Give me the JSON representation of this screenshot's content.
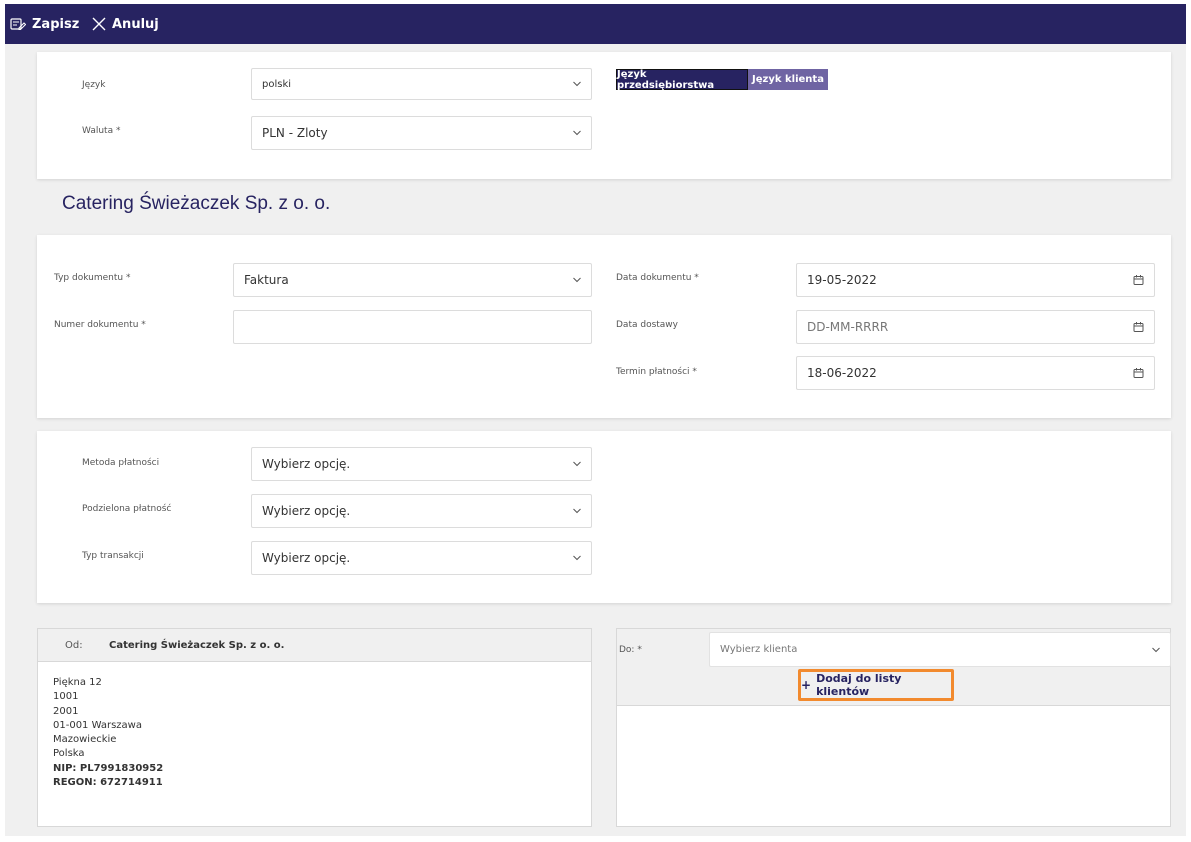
{
  "toolbar": {
    "save_label": "Zapisz",
    "cancel_label": "Anuluj"
  },
  "language_section": {
    "language_label": "Język",
    "language_value": "polski",
    "currency_label": "Waluta *",
    "currency_value": "PLN - Zloty",
    "toggle": {
      "company_language": "Język przedsiębiorstwa",
      "client_language": "Język klienta"
    }
  },
  "company_name": "Catering Świeżaczek Sp. z o. o.",
  "document": {
    "type_label": "Typ dokumentu *",
    "type_value": "Faktura",
    "number_label": "Numer dokumentu *",
    "number_value": "",
    "date_label": "Data dokumentu *",
    "date_value": "19-05-2022",
    "delivery_label": "Data dostawy",
    "delivery_placeholder": "DD-MM-RRRR",
    "due_label": "Termin płatności *",
    "due_value": "18-06-2022"
  },
  "payment": {
    "method_label": "Metoda płatności",
    "method_value": "Wybierz opcję.",
    "split_label": "Podzielona płatność",
    "split_value": "Wybierz opcję.",
    "transaction_label": "Typ transakcji",
    "transaction_value": "Wybierz opcję."
  },
  "from": {
    "label": "Od:",
    "name": "Catering Świeżaczek Sp. z o. o.",
    "lines": [
      "Piękna 12",
      "1001",
      "2001",
      "01-001 Warszawa",
      "Mazowieckie",
      "Polska"
    ],
    "nip": "NIP: PL7991830952",
    "regon": "REGON: 672714911"
  },
  "to": {
    "label": "Do: *",
    "client_placeholder": "Wybierz klienta",
    "add_button": "Dodaj do listy klientów"
  },
  "colors": {
    "primary": "#272361",
    "secondary": "#6f64a3",
    "highlight": "#f28a2e",
    "background": "#f0f0f0"
  }
}
